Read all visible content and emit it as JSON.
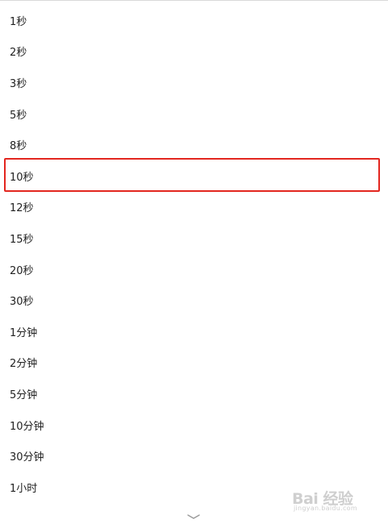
{
  "options": [
    {
      "label": "1秒"
    },
    {
      "label": "2秒"
    },
    {
      "label": "3秒"
    },
    {
      "label": "5秒"
    },
    {
      "label": "8秒"
    },
    {
      "label": "10秒"
    },
    {
      "label": "12秒"
    },
    {
      "label": "15秒"
    },
    {
      "label": "20秒"
    },
    {
      "label": "30秒"
    },
    {
      "label": "1分钟"
    },
    {
      "label": "2分钟"
    },
    {
      "label": "5分钟"
    },
    {
      "label": "10分钟"
    },
    {
      "label": "30分钟"
    },
    {
      "label": "1小时"
    }
  ],
  "highlighted_option": "10秒",
  "highlight_color": "#e3261f",
  "scroll_indicator_icon": "chevron-down-icon",
  "watermark": {
    "brand": "Bai 经验",
    "url": "jingyan.baidu.com"
  }
}
